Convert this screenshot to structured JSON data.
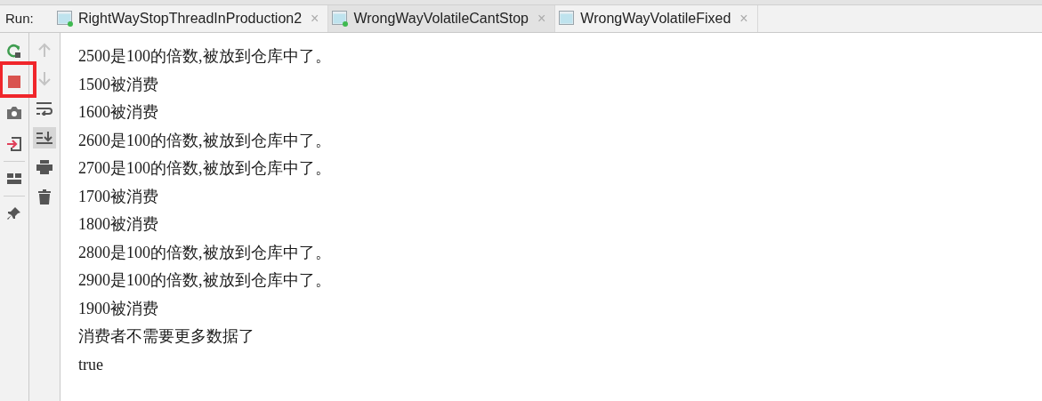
{
  "run_label": "Run:",
  "tabs": [
    {
      "label": "RightWayStopThreadInProduction2",
      "selected": false,
      "running": true,
      "close": "×"
    },
    {
      "label": "WrongWayVolatileCantStop",
      "selected": true,
      "running": true,
      "close": "×"
    },
    {
      "label": "WrongWayVolatileFixed",
      "selected": false,
      "running": false,
      "close": "×"
    }
  ],
  "left_toolbar": [
    {
      "kind": "rerun"
    },
    {
      "kind": "stop",
      "highlighted": true
    },
    {
      "kind": "camera"
    },
    {
      "kind": "exit"
    },
    {
      "kind": "divider"
    },
    {
      "kind": "layout"
    },
    {
      "kind": "divider"
    },
    {
      "kind": "pin"
    }
  ],
  "right_toolbar": [
    {
      "kind": "up",
      "disabled": true
    },
    {
      "kind": "down",
      "disabled": true
    },
    {
      "kind": "wrap",
      "selected": false
    },
    {
      "kind": "scroll-end",
      "selected": true
    },
    {
      "kind": "print",
      "selected": false
    },
    {
      "kind": "trash",
      "selected": false
    }
  ],
  "console_lines": [
    "2500是100的倍数,被放到仓库中了。",
    "1500被消费",
    "1600被消费",
    "2600是100的倍数,被放到仓库中了。",
    "2700是100的倍数,被放到仓库中了。",
    "1700被消费",
    "1800被消费",
    "2800是100的倍数,被放到仓库中了。",
    "2900是100的倍数,被放到仓库中了。",
    "1900被消费",
    "消费者不需要更多数据了",
    "true"
  ]
}
